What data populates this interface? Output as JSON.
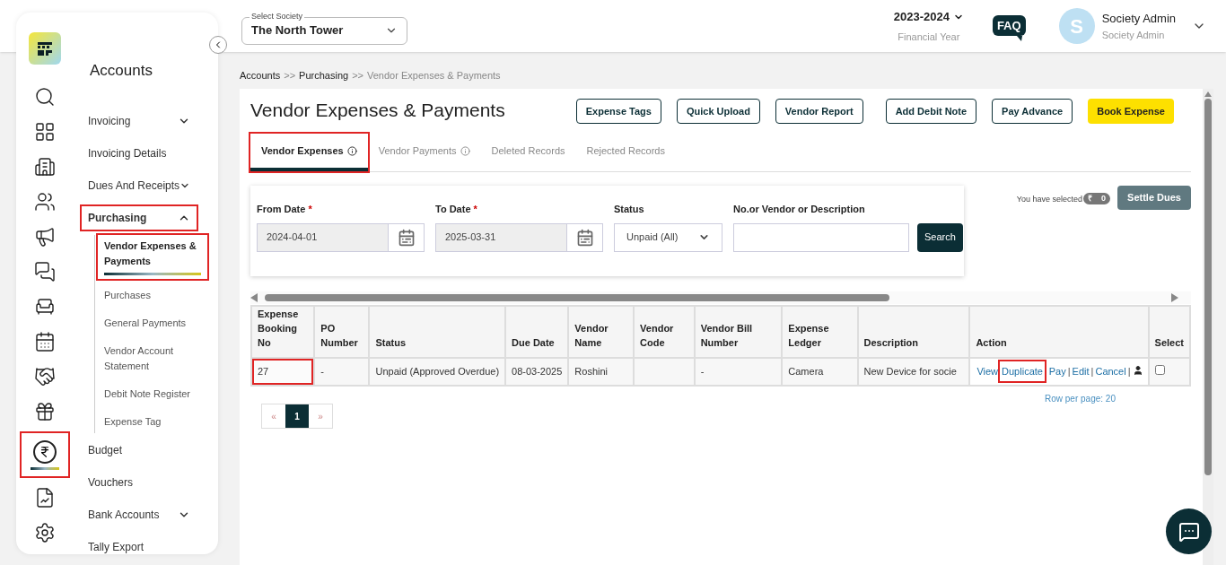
{
  "header": {
    "society_select": {
      "legend": "Select Society",
      "value": "The North Tower"
    },
    "year": {
      "value": "2023-2024",
      "caption": "Financial Year"
    },
    "faq": "FAQ",
    "user": {
      "initial": "S",
      "name": "Society Admin",
      "role": "Society Admin"
    }
  },
  "rail": [
    {
      "selected": false,
      "highlighted": false
    },
    {
      "selected": false,
      "highlighted": false
    },
    {
      "selected": false,
      "highlighted": false
    },
    {
      "selected": false,
      "highlighted": false
    },
    {
      "selected": false,
      "highlighted": false
    },
    {
      "selected": false,
      "highlighted": false
    },
    {
      "selected": false,
      "highlighted": false
    },
    {
      "selected": false,
      "highlighted": false
    },
    {
      "selected": false,
      "highlighted": false
    },
    {
      "selected": false,
      "highlighted": false
    },
    {
      "selected": true,
      "highlighted": true
    },
    {
      "selected": false,
      "highlighted": false
    },
    {
      "selected": false,
      "highlighted": false
    }
  ],
  "menu": {
    "title": "Accounts",
    "items": [
      {
        "label": "Invoicing",
        "kind": "group",
        "expanded": false,
        "highlighted": false
      },
      {
        "label": "Invoicing Details",
        "kind": "link",
        "highlighted": false
      },
      {
        "label": "Dues And Receipts",
        "kind": "group",
        "expanded": false,
        "highlighted": false
      },
      {
        "label": "Purchasing",
        "kind": "group",
        "expanded": true,
        "highlighted": true,
        "children": [
          {
            "label": "Vendor Expenses & Payments",
            "selected": true,
            "highlighted": true
          },
          {
            "label": "Purchases",
            "selected": false,
            "highlighted": false
          },
          {
            "label": "General Payments",
            "selected": false,
            "highlighted": false
          },
          {
            "label": "Vendor Account Statement",
            "selected": false,
            "highlighted": false
          },
          {
            "label": "Debit Note Register",
            "selected": false,
            "highlighted": false
          },
          {
            "label": "Expense Tag",
            "selected": false,
            "highlighted": false
          }
        ]
      },
      {
        "label": "Budget",
        "kind": "link",
        "highlighted": false
      },
      {
        "label": "Vouchers",
        "kind": "link",
        "highlighted": false
      },
      {
        "label": "Bank Accounts",
        "kind": "group",
        "expanded": false,
        "highlighted": false
      },
      {
        "label": "Tally Export",
        "kind": "link",
        "highlighted": false
      }
    ]
  },
  "breadcrumb": [
    {
      "label": "Accounts",
      "current": false
    },
    {
      "label": "Purchasing",
      "current": false
    },
    {
      "label": "Vendor Expenses & Payments",
      "current": true
    }
  ],
  "separator": ">>",
  "required_mark": "*",
  "link_separator": "|",
  "page_title": "Vendor Expenses & Payments",
  "actions": [
    {
      "label": "Expense Tags",
      "kind": "outline"
    },
    {
      "label": "Quick Upload",
      "kind": "outline"
    },
    {
      "label": "Vendor Report",
      "kind": "outline"
    },
    {
      "label": "Add Debit Note",
      "kind": "outline"
    },
    {
      "label": "Pay Advance",
      "kind": "outline"
    },
    {
      "label": "Book Expense",
      "kind": "primary"
    }
  ],
  "tabs": [
    {
      "label": "Vendor Expenses",
      "info": true,
      "selected": true,
      "highlighted": true
    },
    {
      "label": "Vendor Payments",
      "info": true,
      "selected": false,
      "highlighted": false
    },
    {
      "label": "Deleted Records",
      "info": false,
      "selected": false,
      "highlighted": false
    },
    {
      "label": "Rejected Records",
      "info": false,
      "selected": false,
      "highlighted": false
    }
  ],
  "filters": [
    {
      "label": "From Date",
      "required": true,
      "kind": "date",
      "value": "2024-04-01"
    },
    {
      "label": "To Date",
      "required": true,
      "kind": "date",
      "value": "2025-03-31"
    },
    {
      "label": "Status",
      "required": false,
      "kind": "select",
      "value": "Unpaid (All)"
    },
    {
      "label": "No.or Vendor or Description",
      "required": false,
      "kind": "text"
    }
  ],
  "search_button": "Search",
  "selection": {
    "label": "You have selected",
    "currency": "₹",
    "count": "0"
  },
  "settle_button": "Settle Dues",
  "table": {
    "columns": [
      "Expense Booking No",
      "PO Number",
      "Status",
      "Due Date",
      "Vendor Name",
      "Vendor Code",
      "Vendor Bill Number",
      "Expense Ledger",
      "Description",
      "Action",
      "Select"
    ],
    "rows": [
      {
        "cells": [
          {
            "text": "27",
            "highlighted": true
          },
          {
            "text": "-",
            "highlighted": false
          },
          {
            "text": "Unpaid (Approved Overdue)",
            "highlighted": false
          },
          {
            "text": "08-03-2025",
            "highlighted": false
          },
          {
            "text": "Roshini",
            "highlighted": false
          },
          {
            "highlighted": false
          },
          {
            "text": "-",
            "highlighted": false
          },
          {
            "text": "Camera",
            "highlighted": false
          },
          {
            "text": "New Device for socie",
            "highlighted": false
          }
        ],
        "actions": [
          {
            "label": "View",
            "highlighted": false
          },
          {
            "label": "Duplicate",
            "highlighted": true
          },
          {
            "label": "Pay",
            "highlighted": false
          },
          {
            "label": "Edit",
            "highlighted": false
          },
          {
            "label": "Cancel",
            "highlighted": false
          }
        ],
        "checked": false
      }
    ]
  },
  "rows_per_page": "Row per page: 20",
  "pagination": [
    {
      "label": "«",
      "selected": false
    },
    {
      "label": "1",
      "selected": true
    },
    {
      "label": "»",
      "selected": false
    }
  ]
}
